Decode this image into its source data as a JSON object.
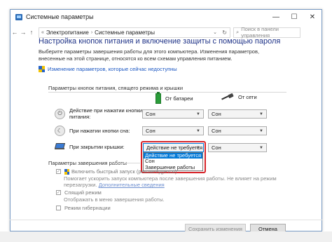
{
  "window": {
    "title": "Системные параметры",
    "controls": [
      "—",
      "☐",
      "✕"
    ]
  },
  "address": {
    "back": "←",
    "forward": "→",
    "up": "↑",
    "root_sep": "«",
    "crumb1": "Электропитание",
    "sep": "›",
    "crumb2": "Системные параметры",
    "dropdown": "⌄",
    "refresh": "↻",
    "search_placeholder": "Поиск в панели управления",
    "search_glyph": "⌕"
  },
  "heading": "Настройка кнопок питания и включение защиты с помощью пароля",
  "description": "Выберите параметры завершения работы для этого компьютера. Изменения параметров, внесенные на этой странице, относятся ко всем схемам управления питанием.",
  "change_link": "Изменение параметров, которые сейчас недоступны",
  "buttons_section": "Параметры кнопок питания, спящего режима и крышки",
  "columns": {
    "battery": "От батареи",
    "ac": "От сети"
  },
  "rows": [
    {
      "label_line1": "Действие при нажатии кнопки",
      "label_line2": "питания:",
      "icon": "power-icon",
      "glyph": "⏻",
      "battery": "Сон",
      "ac": "Сон"
    },
    {
      "label_line1": "При нажатии кнопки сна:",
      "label_line2": "",
      "icon": "moon-icon",
      "glyph": "☾",
      "battery": "Сон",
      "ac": "Сон"
    },
    {
      "label_line1": "При закрытии крышки:",
      "label_line2": "",
      "icon": "laptop-lid-icon",
      "battery": "Действие не требуется",
      "ac": "Сон"
    }
  ],
  "dropdown_options": [
    "Действие не требуется",
    "Сон",
    "Завершение работы"
  ],
  "dropdown_selected": "Действие не требуется",
  "shutdown_section": "Параметры завершения работы",
  "fast_startup": {
    "label": "Включить быстрый запуск (рекомендуется)",
    "desc_line1": "Помогает ускорить запуск компьютера после завершения работы. Не влияет на режим",
    "desc_line2": "перезагрузки.",
    "link": "Дополнительные сведения",
    "checked": true
  },
  "sleep_mode": {
    "label": "Спящий режим",
    "desc": "Отображать в меню завершения работы.",
    "checked": true
  },
  "hibernate": {
    "label": "Режим гибернации",
    "checked": false
  },
  "footer": {
    "save": "Сохранить изменения",
    "cancel": "Отмена"
  },
  "colors": {
    "heading": "#1e3287",
    "link": "#1a56c2",
    "highlight_outline": "#d7252a",
    "selection": "#0078d7"
  }
}
